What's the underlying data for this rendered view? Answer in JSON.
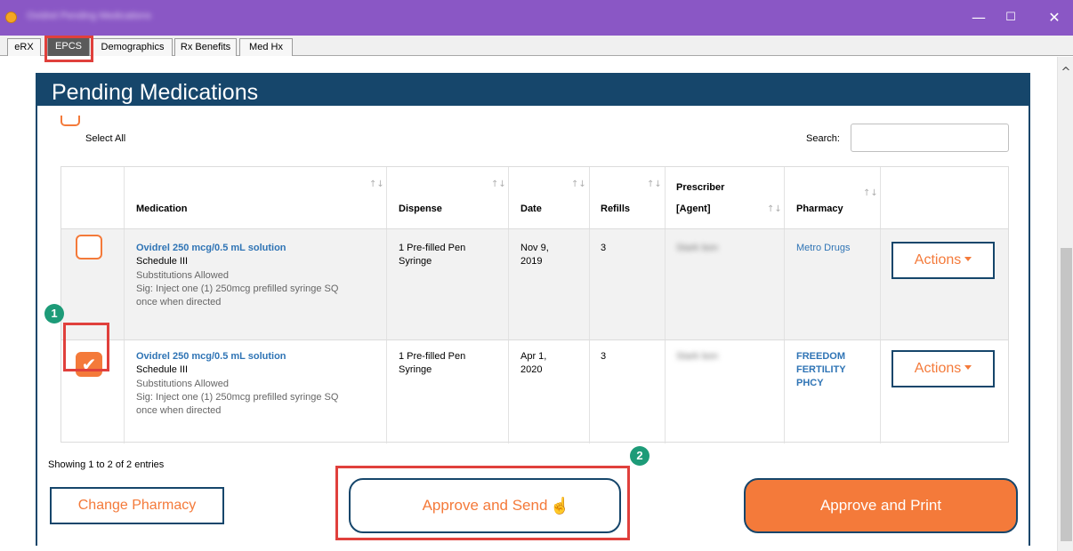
{
  "window": {
    "title": "Ovidrel Pending Medications",
    "minimize_icon": "minimize-icon",
    "maximize_icon": "maximize-icon",
    "close_icon": "close-icon"
  },
  "tabs": [
    {
      "label": "eRX",
      "active": false
    },
    {
      "label": "EPCS",
      "active": true
    },
    {
      "label": "Demographics",
      "active": false
    },
    {
      "label": "Rx Benefits",
      "active": false
    },
    {
      "label": "Med Hx",
      "active": false
    }
  ],
  "panel": {
    "title": "Pending Medications",
    "select_all_label": "Select All",
    "search_label": "Search:",
    "search_value": ""
  },
  "table": {
    "headers": {
      "medication": "Medication",
      "dispense": "Dispense",
      "date": "Date",
      "refills": "Refills",
      "prescriber_line1": "Prescriber",
      "prescriber_line2": "[Agent]",
      "pharmacy": "Pharmacy"
    },
    "sort_icon": "↑↓",
    "rows": [
      {
        "checked": false,
        "medication_name": "Ovidrel 250 mcg/0.5 mL solution",
        "schedule": "Schedule III",
        "substitutions": "Substitutions Allowed",
        "sig_line1": "Sig: Inject one (1) 250mcg prefilled syringe SQ",
        "sig_line2": "once when directed",
        "dispense_line1": "1 Pre-filled Pen",
        "dispense_line2": "Syringe",
        "date_line1": "Nov 9,",
        "date_line2": "2019",
        "refills": "3",
        "prescriber": "Stark bon",
        "pharmacy_line1": "Metro Drugs",
        "actions_label": "Actions"
      },
      {
        "checked": true,
        "medication_name": "Ovidrel 250 mcg/0.5 mL solution",
        "schedule": "Schedule III",
        "substitutions": "Substitutions Allowed",
        "sig_line1": "Sig: Inject one (1) 250mcg prefilled syringe SQ",
        "sig_line2": "once when directed",
        "dispense_line1": "1 Pre-filled Pen",
        "dispense_line2": "Syringe",
        "date_line1": "Apr 1,",
        "date_line2": "2020",
        "refills": "3",
        "prescriber": "Stark bon",
        "pharmacy_line1": "FREEDOM",
        "pharmacy_line2": "FERTILITY",
        "pharmacy_line3": "PHCY",
        "actions_label": "Actions"
      }
    ]
  },
  "footer": {
    "entries_text": "Showing 1 to 2 of 2 entries",
    "change_pharmacy_label": "Change Pharmacy",
    "approve_send_label": "Approve and Send",
    "approve_print_label": "Approve and Print"
  },
  "callouts": {
    "marker1": "1",
    "marker2": "2"
  },
  "colors": {
    "accent": "#f47a3a",
    "header_navy": "#16466b",
    "titlebar": "#8a57c5",
    "callout_red": "#e0403c",
    "marker_green": "#1d9b78",
    "link_blue": "#2f74b5"
  }
}
